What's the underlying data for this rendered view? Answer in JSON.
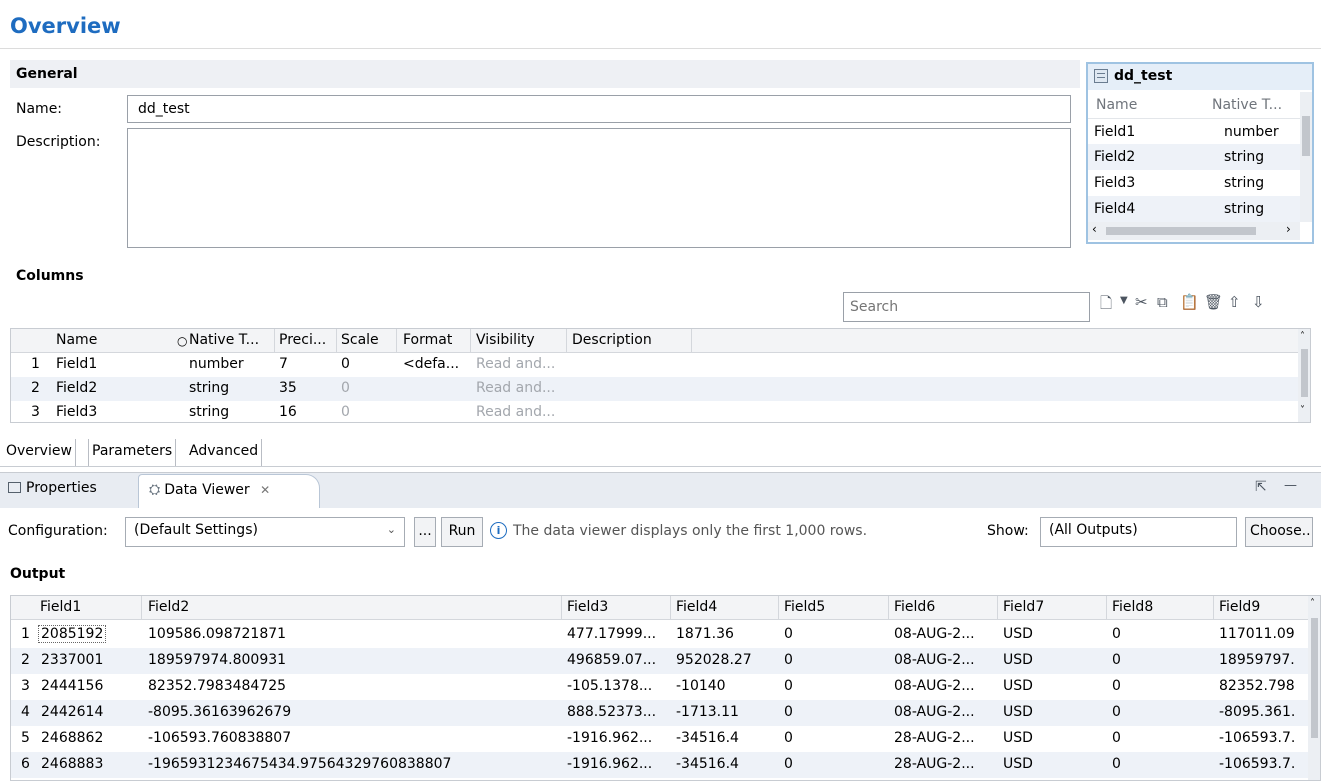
{
  "overview": {
    "title": "Overview"
  },
  "general": {
    "header": "General",
    "name_label": "Name:",
    "name_value": "dd_test",
    "description_label": "Description:",
    "description_value": ""
  },
  "right_panel": {
    "title": "dd_test",
    "columns": [
      "Name",
      "Native T..."
    ],
    "rows": [
      {
        "name": "Field1",
        "type": "number"
      },
      {
        "name": "Field2",
        "type": "string"
      },
      {
        "name": "Field3",
        "type": "string"
      },
      {
        "name": "Field4",
        "type": "string"
      }
    ]
  },
  "columns_section": {
    "header": "Columns",
    "search_placeholder": "Search",
    "grid_headers": [
      "Name",
      "Native T...",
      "Preci...",
      "Scale",
      "Format",
      "Visibility",
      "Description"
    ],
    "rows": [
      {
        "num": "1",
        "name": "Field1",
        "type": "number",
        "precision": "7",
        "scale": "0",
        "format": "<defa...",
        "visibility": "Read and...",
        "description": ""
      },
      {
        "num": "2",
        "name": "Field2",
        "type": "string",
        "precision": "35",
        "scale": "0",
        "format": "",
        "visibility": "Read and...",
        "description": ""
      },
      {
        "num": "3",
        "name": "Field3",
        "type": "string",
        "precision": "16",
        "scale": "0",
        "format": "",
        "visibility": "Read and...",
        "description": ""
      }
    ]
  },
  "editor_tabs": [
    "Overview",
    "Parameters",
    "Advanced"
  ],
  "views": {
    "properties_tab": "Properties",
    "data_viewer_tab": "Data Viewer"
  },
  "config": {
    "label": "Configuration:",
    "selected": "(Default Settings)",
    "more_button": "...",
    "run_button": "Run",
    "info_text": "The data viewer displays only the first 1,000 rows.",
    "show_label": "Show:",
    "show_value": "(All Outputs)",
    "choose_button": "Choose..."
  },
  "output": {
    "header": "Output",
    "columns": [
      "Field1",
      "Field2",
      "Field3",
      "Field4",
      "Field5",
      "Field6",
      "Field7",
      "Field8",
      "Field9"
    ],
    "rows": [
      [
        "1",
        "2085192",
        "109586.098721871",
        "477.17999...",
        "1871.36",
        "0",
        "08-AUG-2...",
        "USD",
        "0",
        "117011.09"
      ],
      [
        "2",
        "2337001",
        "189597974.800931",
        "496859.07...",
        "952028.27",
        "0",
        "08-AUG-2...",
        "USD",
        "0",
        "18959797."
      ],
      [
        "3",
        "2444156",
        "82352.7983484725",
        "-105.1378...",
        "-10140",
        "0",
        "08-AUG-2...",
        "USD",
        "0",
        "82352.798"
      ],
      [
        "4",
        "2442614",
        "-8095.36163962679",
        "888.52373...",
        "-1713.11",
        "0",
        "08-AUG-2...",
        "USD",
        "0",
        "-8095.361."
      ],
      [
        "5",
        "2468862",
        "-106593.760838807",
        "-1916.962...",
        "-34516.4",
        "0",
        "28-AUG-2...",
        "USD",
        "0",
        "-106593.7."
      ],
      [
        "6",
        "2468883",
        "-1965931234675434.97564329760838807",
        "-1916.962...",
        "-34516.4",
        "0",
        "28-AUG-2...",
        "USD",
        "0",
        "-106593.7."
      ]
    ]
  }
}
